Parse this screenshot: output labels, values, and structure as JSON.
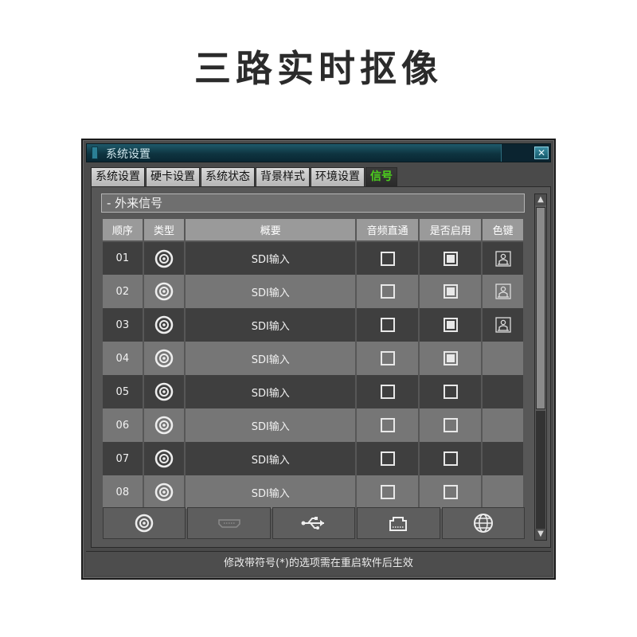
{
  "page_title": "三路实时抠像",
  "window": {
    "title": "系统设置",
    "close_icon": "close-icon"
  },
  "tabs": [
    {
      "label": "系统设置",
      "active": false
    },
    {
      "label": "硬卡设置",
      "active": false
    },
    {
      "label": "系统状态",
      "active": false
    },
    {
      "label": "背景样式",
      "active": false
    },
    {
      "label": "环境设置",
      "active": false
    },
    {
      "label": "信号",
      "active": true
    }
  ],
  "section": {
    "title": "- 外来信号"
  },
  "table": {
    "headers": [
      "顺序",
      "类型",
      "概要",
      "音频直通",
      "是否启用",
      "色键"
    ],
    "rows": [
      {
        "no": "01",
        "type_icon": "disc-icon",
        "summary": "SDI输入",
        "audio": false,
        "enabled": true,
        "key": true
      },
      {
        "no": "02",
        "type_icon": "disc-icon",
        "summary": "SDI输入",
        "audio": false,
        "enabled": true,
        "key": true
      },
      {
        "no": "03",
        "type_icon": "disc-icon",
        "summary": "SDI输入",
        "audio": false,
        "enabled": true,
        "key": true
      },
      {
        "no": "04",
        "type_icon": "disc-icon",
        "summary": "SDI输入",
        "audio": false,
        "enabled": true,
        "key": false
      },
      {
        "no": "05",
        "type_icon": "disc-icon",
        "summary": "SDI输入",
        "audio": false,
        "enabled": false,
        "key": false
      },
      {
        "no": "06",
        "type_icon": "disc-icon",
        "summary": "SDI输入",
        "audio": false,
        "enabled": false,
        "key": false
      },
      {
        "no": "07",
        "type_icon": "disc-icon",
        "summary": "SDI输入",
        "audio": false,
        "enabled": false,
        "key": false
      },
      {
        "no": "08",
        "type_icon": "disc-icon",
        "summary": "SDI输入",
        "audio": false,
        "enabled": false,
        "key": false
      }
    ]
  },
  "bottom_icons": [
    "disc-icon",
    "hdmi-icon",
    "usb-icon",
    "network-icon",
    "globe-icon"
  ],
  "status": {
    "text": "修改带符号(*)的选项需在重启软件后生效"
  },
  "colors": {
    "active_tab": "#4cd11d",
    "titlebar": "#0e3440"
  }
}
